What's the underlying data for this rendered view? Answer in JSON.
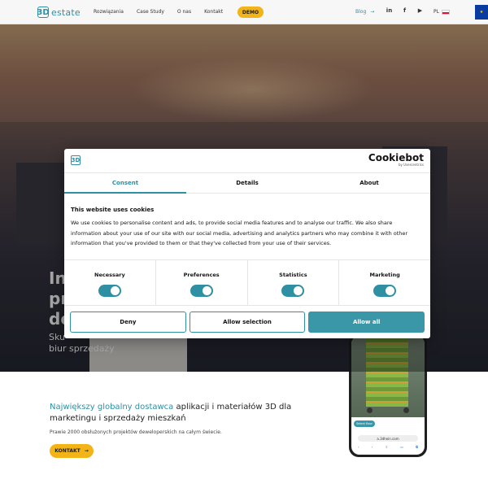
{
  "header": {
    "logo_mark": "3D",
    "logo_text": "estate",
    "nav": [
      "Rozwiązania",
      "Case Study",
      "O nas",
      "Kontakt"
    ],
    "demo_label": "DEMO",
    "blog_label": "Blog",
    "blog_arrow": "→",
    "socials": [
      "in",
      "f",
      "▶"
    ],
    "lang": "PL"
  },
  "hero": {
    "line1": "In",
    "line2": "pr",
    "line3": "de",
    "sub1": "Sku",
    "sub2": "biur sprzedaży"
  },
  "cookie": {
    "logo_mark": "3D",
    "brand_name": "Cookiebot",
    "brand_by": "by Usercentrics",
    "tabs": [
      "Consent",
      "Details",
      "About"
    ],
    "title": "This website uses cookies",
    "text": "We use cookies to personalise content and ads, to provide social media features and to analyse our traffic. We also share information about your use of our site with our social media, advertising and analytics partners who may combine it with other information that you've provided to them or that they've collected from your use of their services.",
    "categories": [
      "Necessary",
      "Preferences",
      "Statistics",
      "Marketing"
    ],
    "buttons": {
      "deny": "Deny",
      "allow_selection": "Allow selection",
      "allow_all": "Allow all"
    }
  },
  "lead": {
    "highlight": "Największy globalny dostawca",
    "rest": " aplikacji i materiałów 3D dla marketingu i sprzedaży mieszkań",
    "sub": "Prawie 2000 obsłużonych projektów deweloperskich na całym świecie.",
    "cta": "KONTAKT",
    "cta_arrow": "→"
  },
  "phone": {
    "chip": "Select floor",
    "url": "a.3dhein.com"
  },
  "colors": {
    "accent": "#2f8fa3",
    "cta": "#f2b416"
  }
}
